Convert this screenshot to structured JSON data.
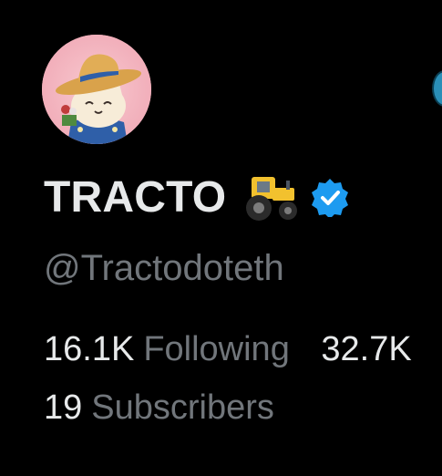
{
  "profile": {
    "avatar_icon": "cowboy-cat-avatar",
    "display_name": "TRACTO",
    "name_emoji": "tractor-icon",
    "verified_icon": "verified-badge-icon",
    "handle": "@Tractodoteth"
  },
  "stats": {
    "following_count": "16.1K",
    "following_label": "Following",
    "followers_count": "32.7K",
    "subscribers_count": "19",
    "subscribers_label": "Subscribers"
  },
  "colors": {
    "background": "#000000",
    "primary_text": "#e7e9ea",
    "secondary_text": "#71767b",
    "verified_blue": "#1d9bf0"
  }
}
